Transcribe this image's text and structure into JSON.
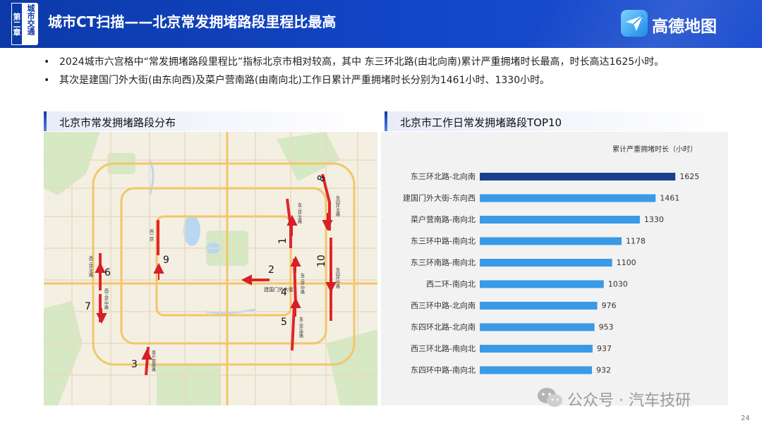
{
  "header": {
    "chapter_number": "第二章",
    "chapter_name": "城市交通",
    "title": "城市CT扫描——北京常发拥堵路段里程比最高",
    "logo_text": "高德地图"
  },
  "bullets": [
    "2024城市六宫格中“常发拥堵路段里程比”指标北京市相对较高，其中 东三环北路(由北向南)累计严重拥堵时长最高，时长高达1625小时。",
    "其次是建国门外大街(由东向西)及菜户营南路(由南向北)工作日累计严重拥堵时长分别为1461小时、1330小时。"
  ],
  "map_section": {
    "title": "北京市常发拥堵路段分布",
    "route_numbers": [
      "1",
      "2",
      "3",
      "4",
      "5",
      "6",
      "7",
      "8",
      "9",
      "10"
    ],
    "road_labels": {
      "r1": "东三环北路",
      "r2": "建国门外大街",
      "r3": "菜户营南路",
      "r4": "东三环中路",
      "r5": "东三环南路",
      "r6": "西三环北路",
      "r7": "西三环中路",
      "r8": "东四环北路",
      "r9": "西二环",
      "r10": "东四环中路"
    }
  },
  "chart_section": {
    "title": "北京市工作日常发拥堵路段TOP10"
  },
  "chart_data": {
    "type": "bar",
    "orientation": "horizontal",
    "title": "北京市工作日常发拥堵路段TOP10",
    "xlabel": "累计严重拥堵时长（小时）",
    "categories": [
      "东三环北路-北向南",
      "建国门外大街-东向西",
      "菜户营南路-南向北",
      "东三环中路-南向北",
      "东三环南路-南向北",
      "西二环-南向北",
      "西三环中路-北向南",
      "东四环北路-北向南",
      "西三环北路-南向北",
      "东四环中路-南向北"
    ],
    "values": [
      1625,
      1461,
      1330,
      1178,
      1100,
      1030,
      976,
      953,
      937,
      932
    ],
    "xlim": [
      0,
      1700
    ],
    "colors": {
      "highlight": "#1e3f8f",
      "bar": "#3a9ae6"
    },
    "grid": false,
    "data_labels": true
  },
  "watermark": {
    "text": "公众号 · 汽车技研",
    "icon": "wechat-icon"
  },
  "page_number": "24",
  "colors": {
    "header_blue": "#0b3aa8",
    "congestion_red": "#e0262b",
    "arrow_red": "#d61f26"
  }
}
